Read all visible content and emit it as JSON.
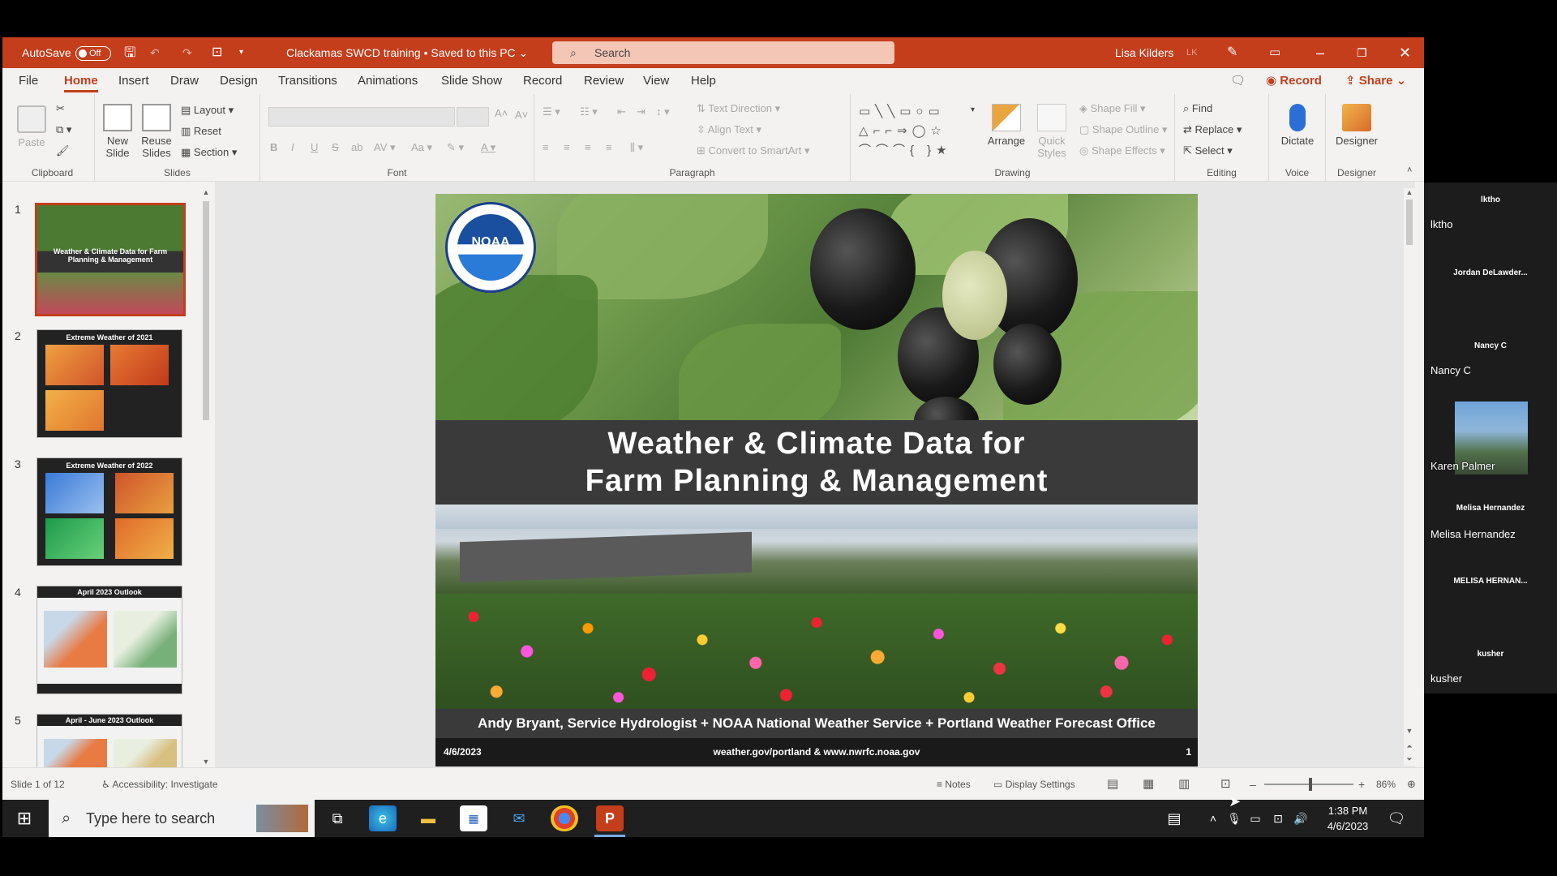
{
  "titlebar": {
    "autosave_label": "AutoSave",
    "autosave_state": "Off",
    "doc_title": "Clackamas SWCD training • Saved to this PC ⌄",
    "search_placeholder": "Search",
    "user_name": "Lisa Kilders",
    "user_initials": "LK"
  },
  "menu": {
    "tabs": [
      "File",
      "Home",
      "Insert",
      "Draw",
      "Design",
      "Transitions",
      "Animations",
      "Slide Show",
      "Record",
      "Review",
      "View",
      "Help"
    ],
    "active_tab": "Home",
    "record_label": "Record",
    "share_label": "Share"
  },
  "ribbon": {
    "clipboard": {
      "paste": "Paste",
      "label": "Clipboard"
    },
    "slides": {
      "new_slide": "New Slide",
      "reuse_slides": "Reuse Slides",
      "layout": "Layout",
      "reset": "Reset",
      "section": "Section",
      "label": "Slides"
    },
    "font": {
      "label": "Font"
    },
    "paragraph": {
      "text_direction": "Text Direction",
      "align_text": "Align Text",
      "convert_smartart": "Convert to SmartArt",
      "label": "Paragraph"
    },
    "drawing": {
      "arrange": "Arrange",
      "quick_styles": "Quick Styles",
      "shape_fill": "Shape Fill",
      "shape_outline": "Shape Outline",
      "shape_effects": "Shape Effects",
      "label": "Drawing"
    },
    "editing": {
      "find": "Find",
      "replace": "Replace",
      "select": "Select",
      "label": "Editing"
    },
    "voice": {
      "dictate": "Dictate",
      "label": "Voice"
    },
    "designer": {
      "designer": "Designer",
      "label": "Designer"
    }
  },
  "thumbnails": [
    {
      "num": "1",
      "title": "Weather & Climate Data for Farm Planning & Management"
    },
    {
      "num": "2",
      "title": "Extreme Weather of 2021"
    },
    {
      "num": "3",
      "title": "Extreme Weather of 2022"
    },
    {
      "num": "4",
      "title": "April 2023 Outlook"
    },
    {
      "num": "5",
      "title": "April - June 2023 Outlook"
    }
  ],
  "slide": {
    "title_line1": "Weather & Climate Data for",
    "title_line2": "Farm Planning & Management",
    "logo_text": "NOAA",
    "credit": "Andy Bryant, Service Hydrologist + NOAA National Weather Service + Portland Weather Forecast Office",
    "date": "4/6/2023",
    "url": "weather.gov/portland & www.nwrfc.noaa.gov",
    "page_num": "1"
  },
  "status": {
    "slide_of": "Slide 1 of 12",
    "accessibility": "Accessibility: Investigate",
    "notes": "Notes",
    "display_settings": "Display Settings",
    "zoom": "86%",
    "zoom_level": 0.52
  },
  "taskbar": {
    "search_placeholder": "Type here to search",
    "time": "1:38 PM",
    "date": "4/6/2023"
  },
  "participants": [
    {
      "tile": "lktho",
      "label": "lktho"
    },
    {
      "tile": "Jordan DeLawder...",
      "label": ""
    },
    {
      "tile": "Nancy C",
      "label": "Nancy C"
    },
    {
      "tile": "",
      "label": "Karen Palmer"
    },
    {
      "tile": "Melisa Hernandez",
      "label": "Melisa Hernandez"
    },
    {
      "tile": "MELISA HERNAN...",
      "label": ""
    },
    {
      "tile": "kusher",
      "label": "kusher"
    }
  ],
  "colors": {
    "accent": "#c43e1c",
    "titlebar": "#c43e1c",
    "ribbon_bg": "#f3f2f1"
  }
}
